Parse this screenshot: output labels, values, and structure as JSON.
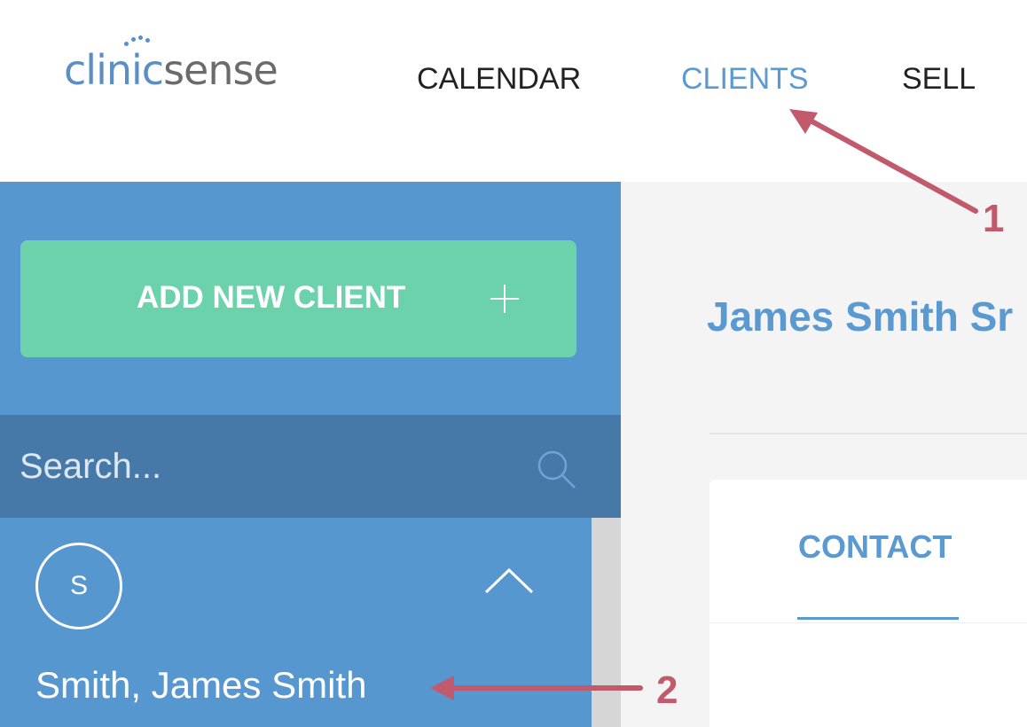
{
  "header": {
    "logo": {
      "part1": "clinic",
      "part2": "sense"
    },
    "nav": {
      "calendar": "CALENDAR",
      "clients": "CLIENTS",
      "sell": "SELL"
    }
  },
  "sidebar": {
    "add_button_label": "ADD NEW CLIENT",
    "search_placeholder": "Search...",
    "client": {
      "avatar_initial": "S",
      "name": "Smith, James Smith"
    }
  },
  "main": {
    "title": "James Smith Sr",
    "tab_contact": "CONTACT"
  },
  "annotations": {
    "marker_1": "1",
    "marker_2": "2"
  },
  "colors": {
    "brand_blue": "#5797d0",
    "accent_blue": "#5b99d1",
    "add_button_green": "#6cd2ab",
    "annotation_red": "#c05a6c"
  },
  "icons": {
    "add": "plus-icon",
    "search": "search-icon",
    "collapse": "chevron-up-icon"
  }
}
